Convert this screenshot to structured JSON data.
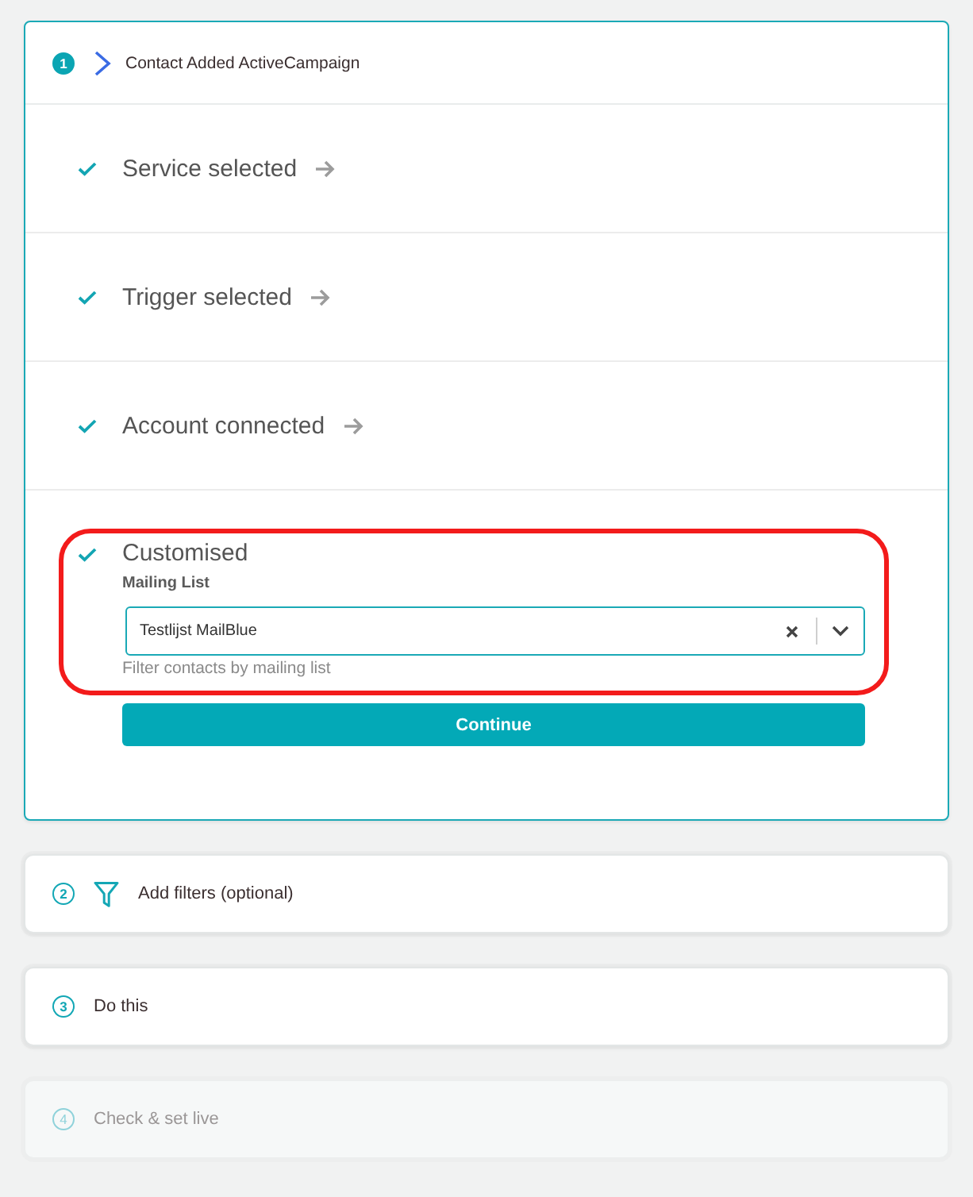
{
  "steps": [
    {
      "number": "1",
      "kind": "trigger",
      "title": "Contact Added ActiveCampaign",
      "expanded": true,
      "disabled": false,
      "sections": [
        {
          "kind": "summary",
          "label": "Service selected",
          "done": true
        },
        {
          "kind": "summary",
          "label": "Trigger selected",
          "done": true
        },
        {
          "kind": "summary",
          "label": "Account connected",
          "done": true
        },
        {
          "kind": "form",
          "label": "Customised",
          "done": true,
          "highlighted": true,
          "field": {
            "label": "Mailing List",
            "value": "Testlijst MailBlue",
            "hint": "Filter contacts by mailing list"
          },
          "button": "Continue"
        }
      ]
    },
    {
      "number": "2",
      "kind": "filter",
      "title": "Add filters (optional)",
      "expanded": false,
      "disabled": false
    },
    {
      "number": "3",
      "kind": "action",
      "title": "Do this",
      "expanded": false,
      "disabled": false
    },
    {
      "number": "4",
      "kind": "review",
      "title": "Check & set live",
      "expanded": false,
      "disabled": true
    }
  ]
}
